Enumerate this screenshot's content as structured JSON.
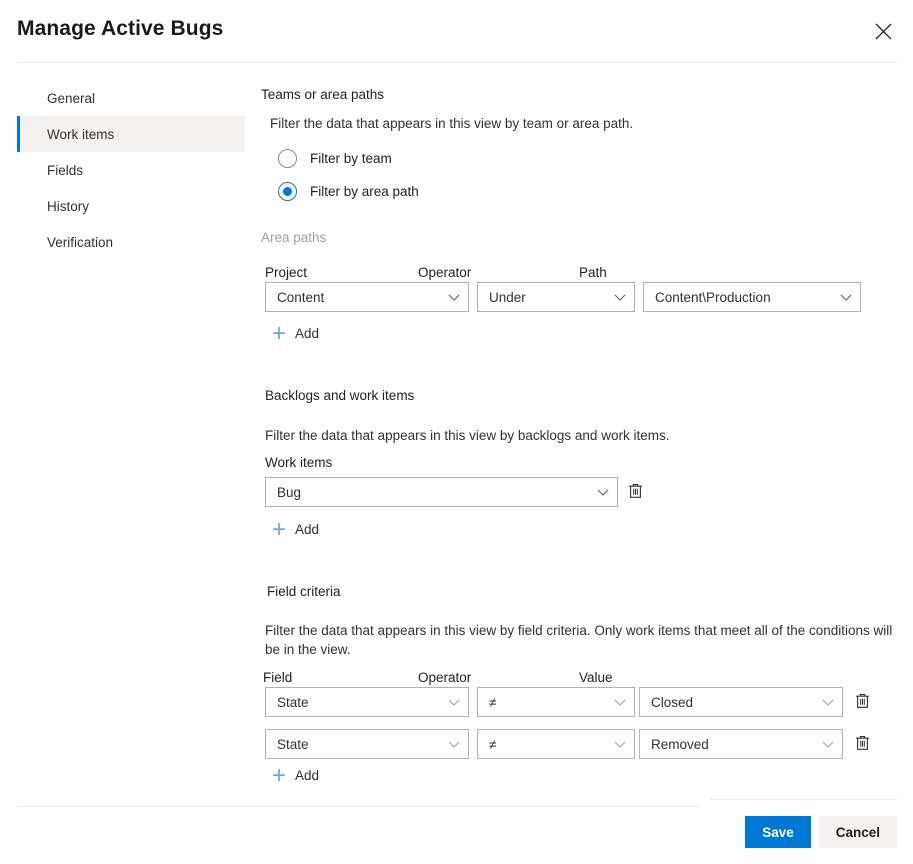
{
  "header": {
    "title": "Manage Active Bugs",
    "close_icon": "close-icon",
    "close_label": "Close"
  },
  "sidebar": {
    "items": [
      {
        "label": "General",
        "selected": false
      },
      {
        "label": "Work items",
        "selected": true
      },
      {
        "label": "Fields",
        "selected": false
      },
      {
        "label": "History",
        "selected": false
      },
      {
        "label": "Verification",
        "selected": false
      }
    ]
  },
  "teams_section": {
    "title": "Teams or area paths",
    "description": "Filter the data that appears in this view by team or area path.",
    "radios": [
      {
        "label": "Filter by team",
        "checked": false
      },
      {
        "label": "Filter by area path",
        "checked": true
      }
    ]
  },
  "area_paths": {
    "group_label": "Area paths",
    "columns": {
      "project": "Project",
      "operator": "Operator",
      "path": "Path"
    },
    "rows": [
      {
        "project": "Content",
        "operator": "Under",
        "path": "Content\\Production"
      }
    ],
    "add_label": "Add"
  },
  "backlogs_section": {
    "title": "Backlogs and work items",
    "description": "Filter the data that appears in this view by backlogs and work items.",
    "field_label": "Work items",
    "rows": [
      {
        "value": "Bug"
      }
    ],
    "add_label": "Add",
    "delete_label": "Delete"
  },
  "field_criteria": {
    "title": "Field criteria",
    "description": "Filter the data that appears in this view by field criteria. Only work items that meet all of the conditions will be in the view.",
    "columns": {
      "field": "Field",
      "operator": "Operator",
      "value": "Value"
    },
    "rows": [
      {
        "field": "State",
        "operator": "≠",
        "value": "Closed"
      },
      {
        "field": "State",
        "operator": "≠",
        "value": "Removed"
      }
    ],
    "add_label": "Add",
    "delete_label": "Delete"
  },
  "footer": {
    "save_label": "Save",
    "cancel_label": "Cancel"
  },
  "colors": {
    "accent": "#0078d4",
    "accent_light": "#67a9e0",
    "selected_bg": "#f3f2f1",
    "border": "#b3b0ad",
    "divider": "#edebe9",
    "muted_text": "#a19f9d"
  }
}
